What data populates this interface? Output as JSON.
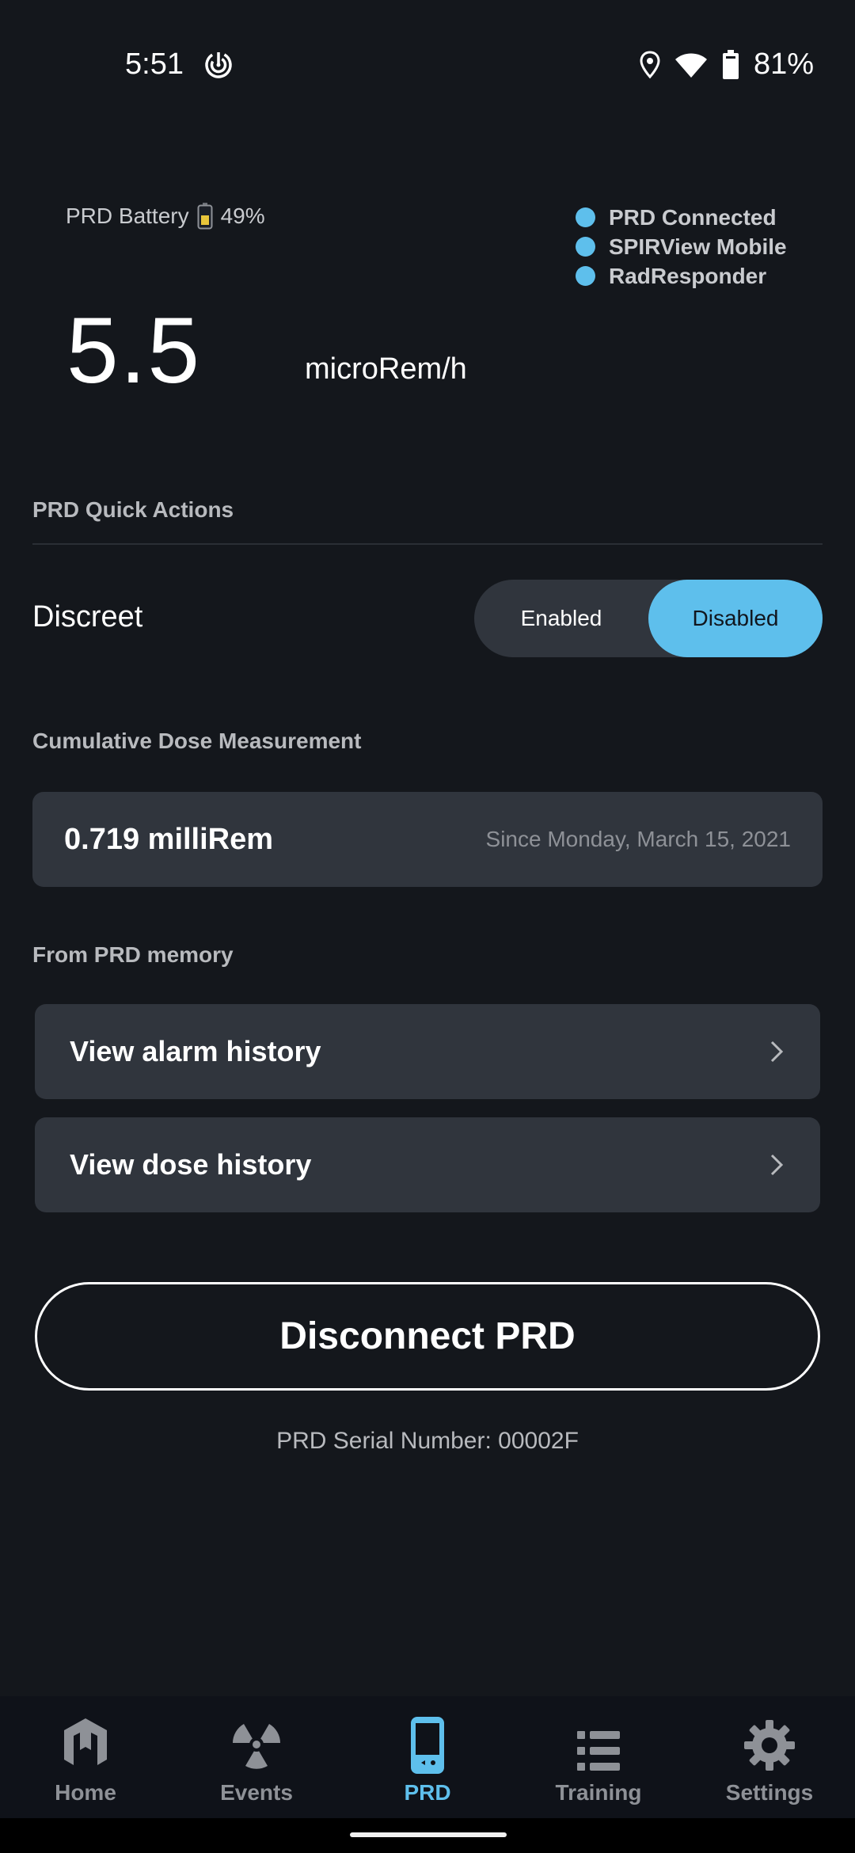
{
  "status_bar": {
    "time": "5:51",
    "left_icons": [
      "radar-icon"
    ],
    "right_icons": [
      "location-icon",
      "wifi-icon",
      "battery-icon"
    ],
    "battery_percent": "81%"
  },
  "header": {
    "prd_battery_label": "PRD Battery",
    "prd_battery_icon": "battery-low-icon",
    "prd_battery_percent": "49%",
    "connections": [
      {
        "label": "PRD Connected",
        "status_color": "#5ebfec"
      },
      {
        "label": "SPIRView Mobile",
        "status_color": "#5ebfec"
      },
      {
        "label": "RadResponder",
        "status_color": "#5ebfec"
      }
    ],
    "reading_value": "5.5",
    "reading_unit": "microRem/h"
  },
  "quick_actions": {
    "section_label": "PRD Quick Actions",
    "discreet_label": "Discreet",
    "toggle_options": [
      "Enabled",
      "Disabled"
    ],
    "toggle_selected": "Disabled"
  },
  "cumulative": {
    "section_label": "Cumulative Dose Measurement",
    "value": "0.719 milliRem",
    "since": "Since Monday, March 15, 2021"
  },
  "memory": {
    "section_label": "From PRD memory",
    "items": [
      {
        "label": "View alarm history",
        "icon": "chevron-right-icon"
      },
      {
        "label": "View dose history",
        "icon": "chevron-right-icon"
      }
    ]
  },
  "disconnect_label": "Disconnect PRD",
  "serial_number": "PRD Serial Number: 00002F",
  "bottom_nav": {
    "tabs": [
      {
        "label": "Home",
        "icon": "home-logo-icon",
        "active": false
      },
      {
        "label": "Events",
        "icon": "radiation-icon",
        "active": false
      },
      {
        "label": "PRD",
        "icon": "device-icon",
        "active": true
      },
      {
        "label": "Training",
        "icon": "list-icon",
        "active": false
      },
      {
        "label": "Settings",
        "icon": "gear-icon",
        "active": false
      }
    ]
  },
  "colors": {
    "accent": "#5ebfec",
    "background": "#14171c",
    "card": "#30353d",
    "battery_warning": "#e8c53a"
  }
}
